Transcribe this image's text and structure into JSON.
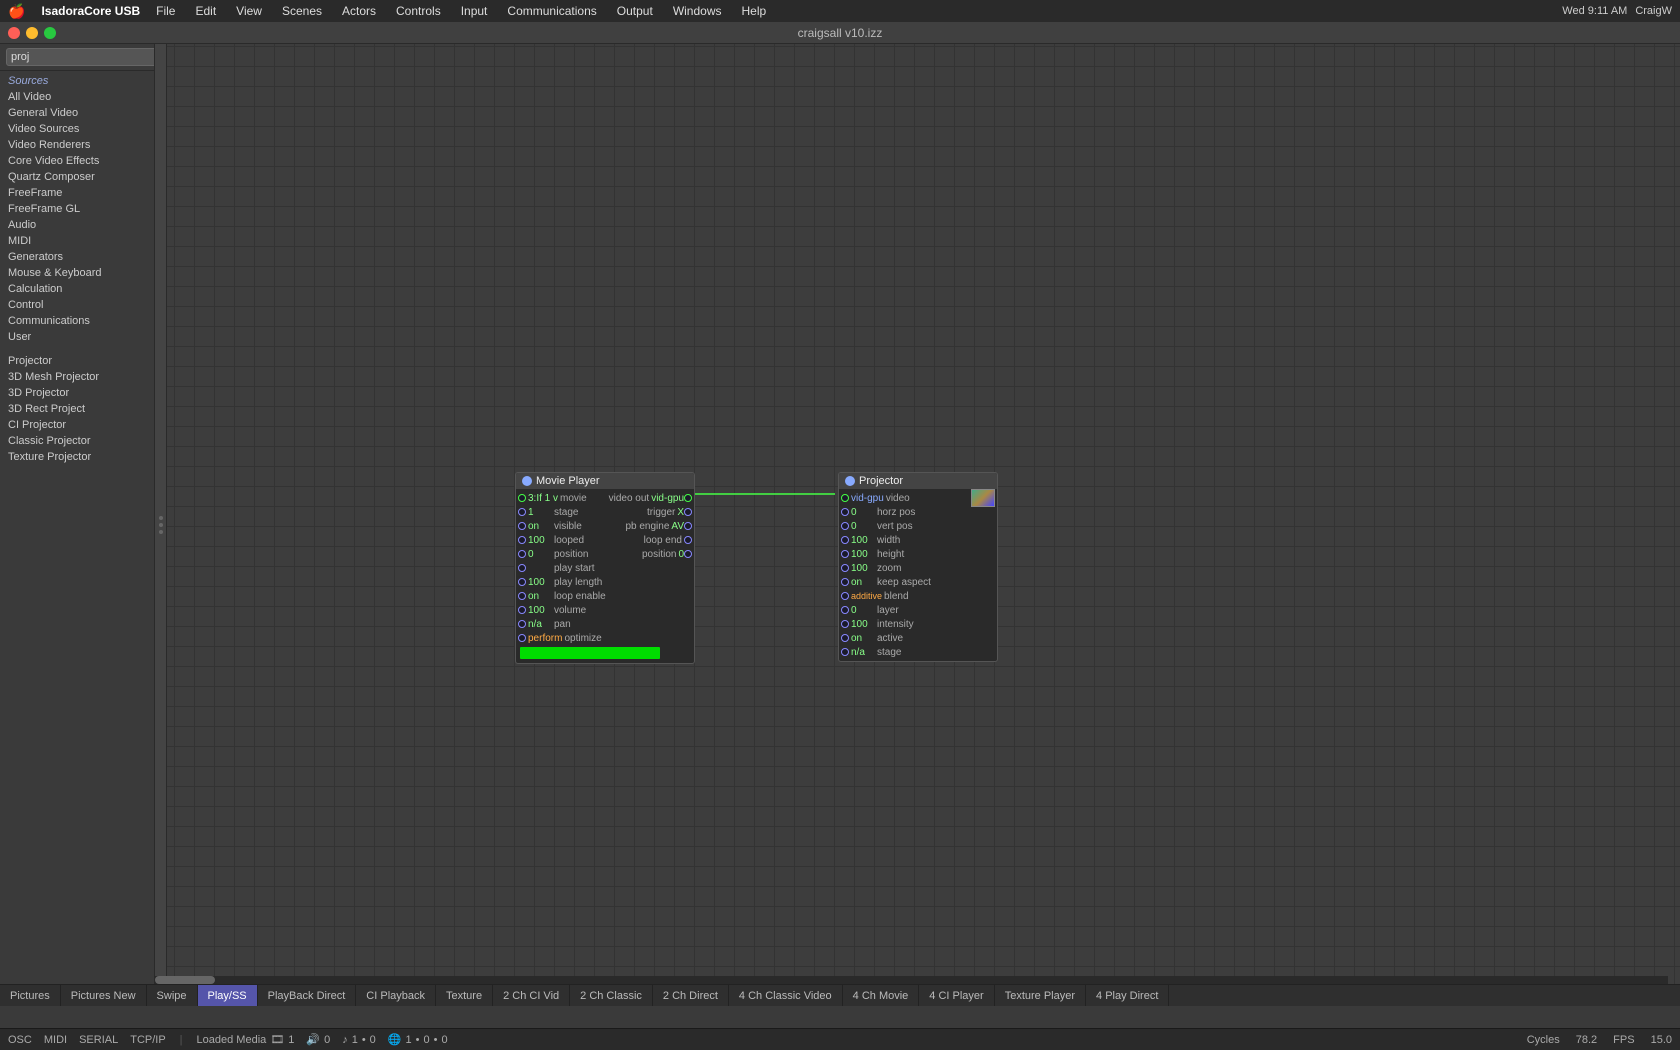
{
  "menubar": {
    "apple": "🍎",
    "app_name": "IsadoraCore USB",
    "items": [
      "File",
      "Edit",
      "View",
      "Scenes",
      "Actors",
      "Controls",
      "Input",
      "Communications",
      "Output",
      "Windows",
      "Help"
    ],
    "right": {
      "time": "Wed 9:11 AM",
      "user": "CraigW"
    }
  },
  "titlebar": {
    "filename": "craigsall v10.izz"
  },
  "sidebar": {
    "search_placeholder": "proj",
    "sources_label": "Sources",
    "categories": [
      "All Video",
      "General Video",
      "Video Sources",
      "Video Renderers",
      "Core Video Effects",
      "Quartz Composer",
      "FreeFrame",
      "FreeFrame GL",
      "Audio",
      "MIDI",
      "Generators",
      "Mouse & Keyboard",
      "Calculation",
      "Control",
      "Communications",
      "User"
    ],
    "projector_items": [
      "Projector",
      "3D Mesh Projector",
      "3D Projector",
      "3D Rect Project",
      "CI Projector",
      "Classic Projector",
      "Texture Projector"
    ]
  },
  "movie_player": {
    "title": "Movie Player",
    "rows": [
      {
        "val": "3:If 1 v",
        "label_left": "movie",
        "label_right": "video out",
        "out_label": "vid-gpu"
      },
      {
        "val": "1",
        "label_left": "stage",
        "label_right": "trigger",
        "out_val": "X"
      },
      {
        "val": "on",
        "label_left": "visible",
        "label_right": "pb engine",
        "out_val": "AV"
      },
      {
        "val": "100",
        "label_left": "looped",
        "label_right": "loop end",
        "out_val": ""
      },
      {
        "val": "0",
        "label_left": "position",
        "label_right": "position",
        "out_val": "0"
      },
      {
        "val": "",
        "label_left": "play start",
        "label_right": "",
        "out_val": ""
      },
      {
        "val": "100",
        "label_left": "play length",
        "label_right": "",
        "out_val": ""
      },
      {
        "val": "on",
        "label_left": "loop enable",
        "label_right": "",
        "out_val": ""
      },
      {
        "val": "100",
        "label_left": "volume",
        "label_right": "",
        "out_val": ""
      },
      {
        "val": "n/a",
        "label_left": "pan",
        "label_right": "",
        "out_val": ""
      },
      {
        "val": "perform",
        "label_left": "optimize",
        "label_right": "",
        "out_val": ""
      }
    ]
  },
  "projector": {
    "title": "Projector",
    "rows": [
      {
        "val": "vid-gpu",
        "label": "video"
      },
      {
        "val": "0",
        "label": "horz pos"
      },
      {
        "val": "0",
        "label": "vert pos"
      },
      {
        "val": "100",
        "label": "width"
      },
      {
        "val": "100",
        "label": "height"
      },
      {
        "val": "100",
        "label": "zoom"
      },
      {
        "val": "on",
        "label": "keep aspect"
      },
      {
        "val": "additive",
        "label": "blend"
      },
      {
        "val": "0",
        "label": "layer"
      },
      {
        "val": "100",
        "label": "intensity"
      },
      {
        "val": "on",
        "label": "active"
      },
      {
        "val": "n/a",
        "label": "stage"
      }
    ]
  },
  "tabs": [
    {
      "label": "Pictures",
      "active": false
    },
    {
      "label": "Pictures New",
      "active": false
    },
    {
      "label": "Swipe",
      "active": false
    },
    {
      "label": "Play/SS",
      "active": true
    },
    {
      "label": "PlayBack Direct",
      "active": false
    },
    {
      "label": "CI Playback",
      "active": false
    },
    {
      "label": "Texture",
      "active": false
    },
    {
      "label": "2 Ch CI Vid",
      "active": false
    },
    {
      "label": "2 Ch Classic",
      "active": false
    },
    {
      "label": "2 Ch Direct",
      "active": false
    },
    {
      "label": "4 Ch Classic Video",
      "active": false
    },
    {
      "label": "4 Ch Movie",
      "active": false
    },
    {
      "label": "4 CI Player",
      "active": false
    },
    {
      "label": "Texture Player",
      "active": false
    },
    {
      "label": "4 Play Direct",
      "active": false
    }
  ],
  "statusbar": {
    "osc_label": "OSC",
    "midi_label": "MIDI",
    "serial_label": "SERIAL",
    "tcpip_label": "TCP/IP",
    "loaded_media_label": "Loaded Media",
    "loaded_media_count": "1",
    "audio_val": "0",
    "midi_val": "1",
    "midi_val2": "0",
    "net_val": "1",
    "net_val2": "0",
    "net_val3": "0",
    "cycles_label": "Cycles",
    "cycles_val": "78.2",
    "fps_label": "FPS",
    "fps_val": "15.0"
  }
}
